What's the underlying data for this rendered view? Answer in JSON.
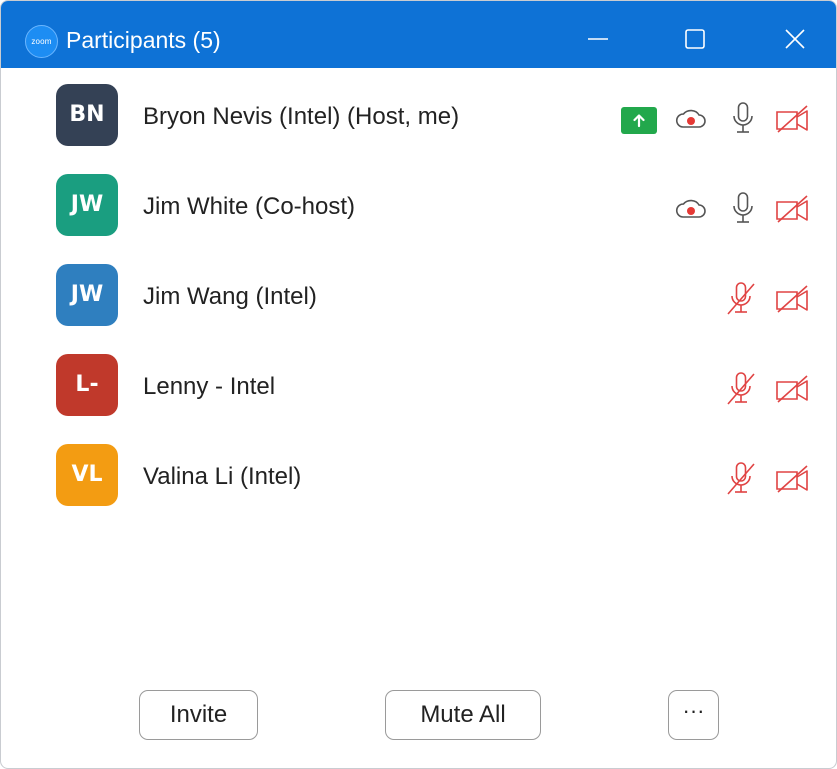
{
  "window": {
    "logo_text": "zoom",
    "title": "Participants (5)"
  },
  "participants": [
    {
      "initials": "BN",
      "name": "Bryon Nevis (Intel) (Host, me)",
      "avatar_color": "#344155",
      "sharing": true,
      "recording": true,
      "mic": "on",
      "video": "off"
    },
    {
      "initials": "JW",
      "name": "Jim White (Co-host)",
      "avatar_color": "#1a9e80",
      "sharing": false,
      "recording": true,
      "mic": "on",
      "video": "off"
    },
    {
      "initials": "JW",
      "name": "Jim Wang (Intel)",
      "avatar_color": "#2f7fbf",
      "sharing": false,
      "recording": false,
      "mic": "muted",
      "video": "off"
    },
    {
      "initials": "L-",
      "name": "Lenny - Intel",
      "avatar_color": "#c0392b",
      "sharing": false,
      "recording": false,
      "mic": "muted",
      "video": "off"
    },
    {
      "initials": "VL",
      "name": "Valina Li (Intel)",
      "avatar_color": "#f39c12",
      "sharing": false,
      "recording": false,
      "mic": "muted",
      "video": "off"
    }
  ],
  "footer": {
    "invite_label": "Invite",
    "mute_all_label": "Mute All",
    "more_label": "···"
  },
  "colors": {
    "titlebar": "#0e72d6",
    "muted_red": "#e04343",
    "share_green": "#22a84c",
    "record_red": "#e53935"
  },
  "icons": {
    "minimize": "minimize-icon",
    "maximize": "maximize-icon",
    "close": "close-icon",
    "share": "share-screen-icon",
    "record": "cloud-recording-icon",
    "mic_on": "microphone-icon",
    "mic_muted": "microphone-muted-icon",
    "video_off": "video-off-icon"
  }
}
